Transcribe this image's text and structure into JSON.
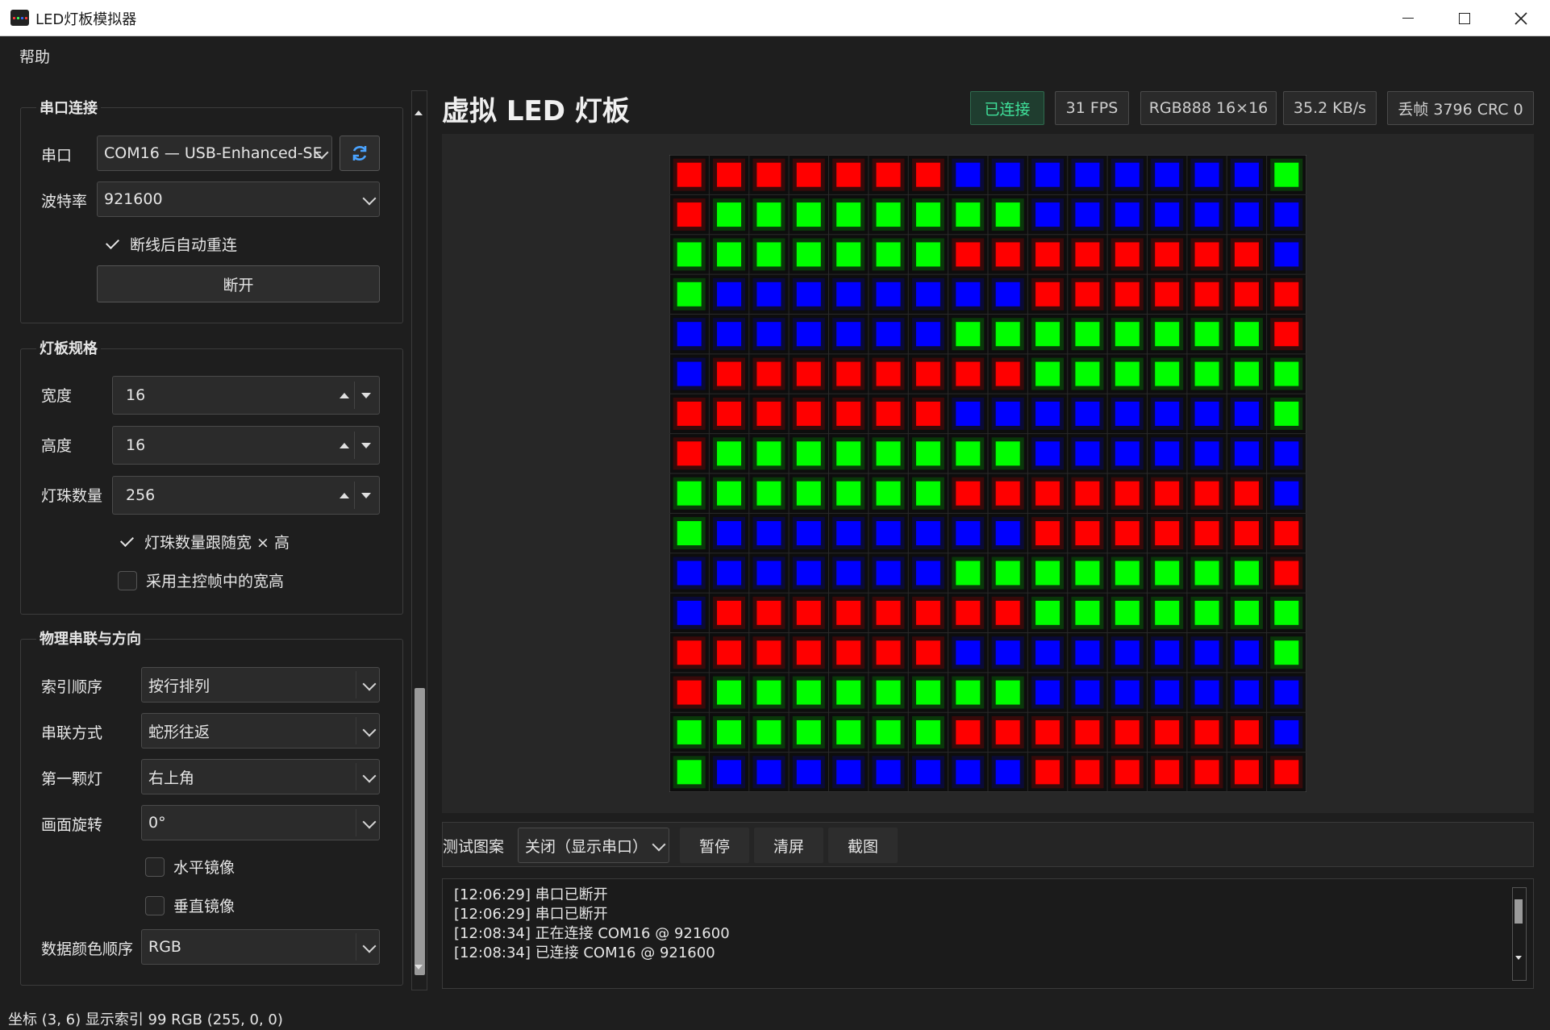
{
  "window": {
    "title": "LED灯板模拟器",
    "controls": {
      "minimize": "─",
      "maximize": "☐",
      "close": "✕"
    }
  },
  "menu": {
    "help": "帮助"
  },
  "serial": {
    "title": "串口连接",
    "port_label": "串口",
    "port_value": "COM16 — USB-Enhanced-SE",
    "refresh_icon": "refresh-icon",
    "baud_label": "波特率",
    "baud_value": "921600",
    "auto_reconnect": {
      "label": "断线后自动重连",
      "checked": true
    },
    "disconnect_button": "断开"
  },
  "panel_spec": {
    "title": "灯板规格",
    "width_label": "宽度",
    "width_value": "16",
    "height_label": "高度",
    "height_value": "16",
    "count_label": "灯珠数量",
    "count_value": "256",
    "follow_checkbox": {
      "label": "灯珠数量跟随宽 × 高",
      "checked": true
    },
    "use_master_checkbox": {
      "label": "采用主控帧中的宽高",
      "checked": false
    }
  },
  "physical": {
    "title": "物理串联与方向",
    "index_order_label": "索引顺序",
    "index_order_value": "按行排列",
    "chain_label": "串联方式",
    "chain_value": "蛇形往返",
    "first_led_label": "第一颗灯",
    "first_led_value": "右上角",
    "rotation_label": "画面旋转",
    "rotation_value": "0°",
    "h_mirror": {
      "label": "水平镜像",
      "checked": false
    },
    "v_mirror": {
      "label": "垂直镜像",
      "checked": false
    },
    "color_order_label": "数据颜色顺序",
    "color_order_value": "RGB"
  },
  "header": {
    "title": "虚拟 LED 灯板",
    "badges": {
      "status": "已连接",
      "fps": "31 FPS",
      "format": "RGB888 16×16",
      "rate": "35.2 KB/s",
      "errors": "丢帧 3796  CRC 0"
    }
  },
  "colors": {
    "R": "#ff0000",
    "G": "#00ff00",
    "B": "#0000ff",
    "connected": "#3fe09a"
  },
  "led_grid": {
    "cols": 16,
    "rows": 16,
    "pixels": [
      "RRRRRRRBBBBBBBBG",
      "RGGGGGGGGBBBBBBB",
      "GGGGGGGRRRRRRRRB",
      "GBBBBBBBBRRRRRRR",
      "BBBBBBBGGGGGGGGR",
      "BRRRRRRRRGGGGGGG",
      "RRRRRRRBBBBBBBBG",
      "RGGGGGGGGBBBBBBB",
      "GGGGGGGRRRRRRRRB",
      "GBBBBBBBBRRRRRRR",
      "BBBBBBBGGGGGGGGR",
      "BRRRRRRRRGGGGGGG",
      "RRRRRRRBBBBBBBBG",
      "RGGGGGGGGBBBBBBB",
      "GGGGGGGRRRRRRRRB",
      "GBBBBBBBBRRRRRRR"
    ]
  },
  "test_bar": {
    "label": "测试图案",
    "pattern_value": "关闭（显示串口）",
    "pause": "暂停",
    "clear": "清屏",
    "screenshot": "截图"
  },
  "log_lines": [
    "[12:06:29] 串口已断开",
    "[12:06:29] 串口已断开",
    "[12:08:34] 正在连接 COM16 @ 921600",
    "[12:08:34] 已连接 COM16 @ 921600"
  ],
  "status_bar": "坐标 (3, 6)   显示索引 99   RGB (255, 0, 0)"
}
